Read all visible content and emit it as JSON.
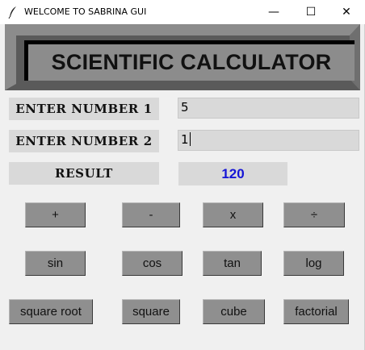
{
  "window": {
    "title": "WELCOME TO SABRINA GUI",
    "minimize_glyph": "—",
    "maximize_glyph": "☐",
    "close_glyph": "✕",
    "icon": "feather-icon"
  },
  "banner": {
    "title": "SCIENTIFIC CALCULATOR"
  },
  "form": {
    "number1_label": "ENTER NUMBER 1",
    "number1_value": "5",
    "number2_label": "ENTER NUMBER 2",
    "number2_value": "1",
    "result_label": "RESULT",
    "result_value": "120"
  },
  "buttons": {
    "add": "+",
    "subtract": "-",
    "multiply": "x",
    "divide": "÷",
    "sin": "sin",
    "cos": "cos",
    "tan": "tan",
    "log": "log",
    "square_root": "square root",
    "square": "square",
    "cube": "cube",
    "factorial": "factorial"
  },
  "colors": {
    "result_text": "#1515d6",
    "button_bg": "#8f8f8f",
    "banner_bg": "#5a5a5a"
  }
}
